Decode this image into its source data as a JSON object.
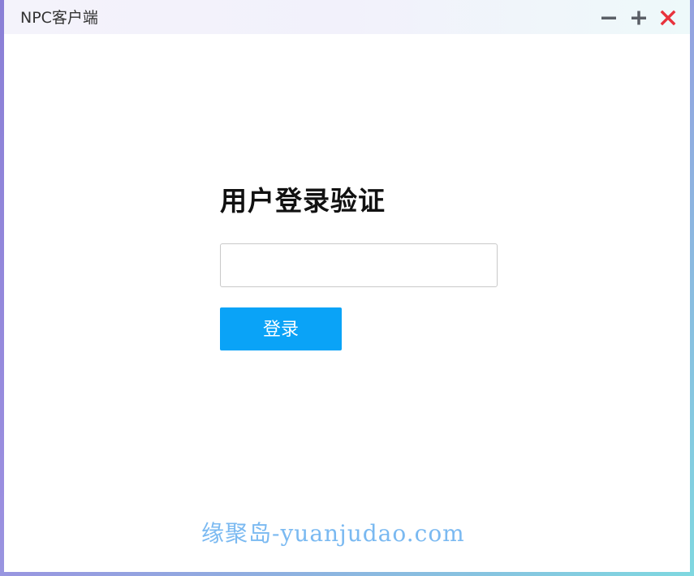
{
  "window": {
    "title": "NPC客户端",
    "controls": {
      "minimize_icon": "minus-icon",
      "maximize_icon": "plus-icon",
      "close_icon": "close-icon",
      "close_color": "#e8323c"
    }
  },
  "login": {
    "heading": "用户登录验证",
    "input_value": "",
    "button_label": "登录",
    "button_color": "#0aa3f7"
  },
  "watermark": {
    "text": "缘聚岛-yuanjudao.com"
  }
}
